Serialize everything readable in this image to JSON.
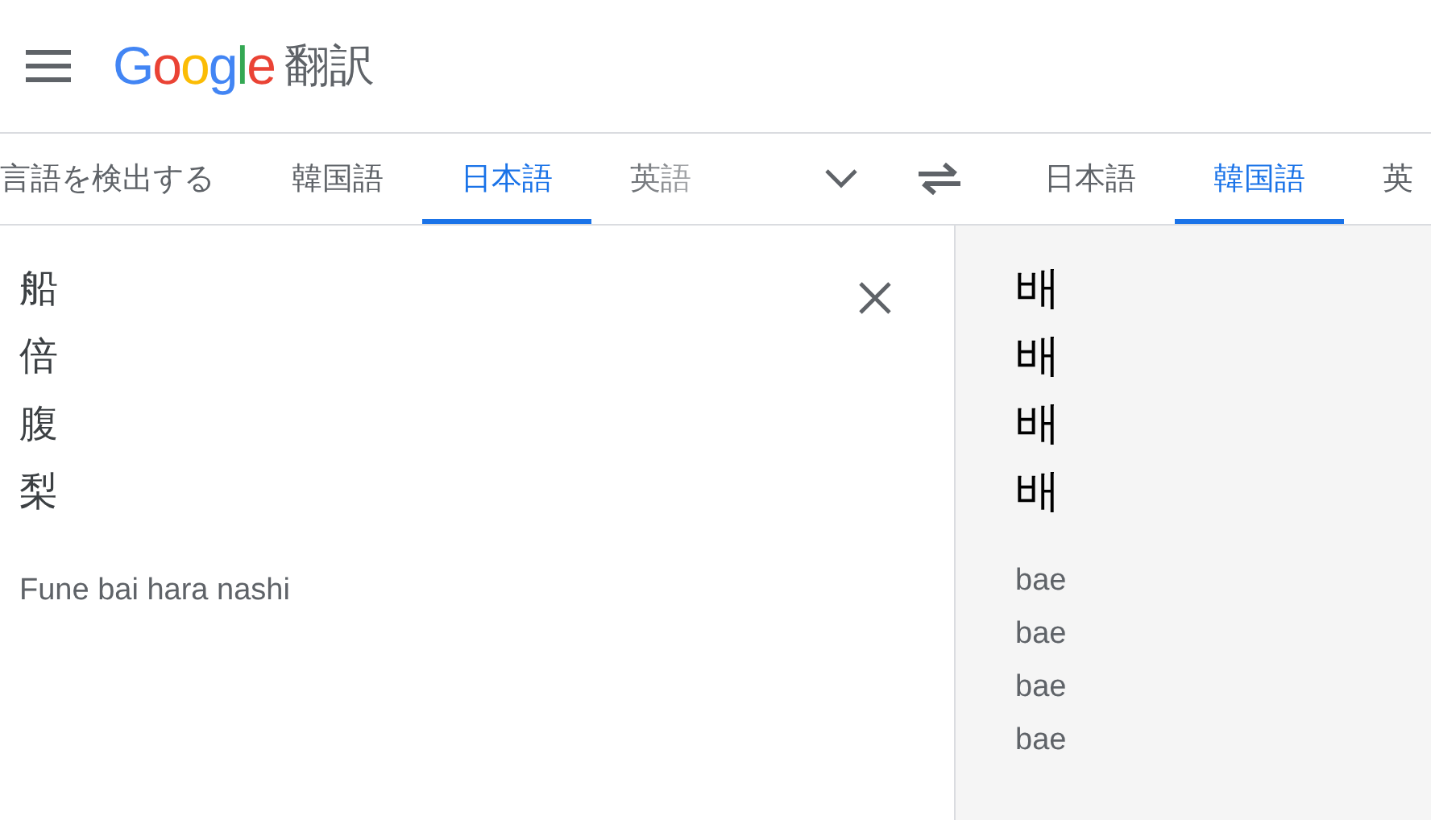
{
  "header": {
    "logo": "Google",
    "title": "翻訳"
  },
  "source_tabs": [
    {
      "label": "言語を検出する",
      "selected": false
    },
    {
      "label": "韓国語",
      "selected": false
    },
    {
      "label": "日本語",
      "selected": true
    },
    {
      "label": "英語",
      "selected": false,
      "faded": true
    }
  ],
  "target_tabs": [
    {
      "label": "日本語",
      "selected": false
    },
    {
      "label": "韓国語",
      "selected": true
    },
    {
      "label": "英",
      "selected": false
    }
  ],
  "source": {
    "lines": [
      "船",
      "倍",
      "腹",
      "梨"
    ],
    "romanization": "Fune bai hara nashi"
  },
  "target": {
    "lines": [
      "배",
      "배",
      "배",
      "배"
    ],
    "romanization": [
      "bae",
      "bae",
      "bae",
      "bae"
    ]
  }
}
